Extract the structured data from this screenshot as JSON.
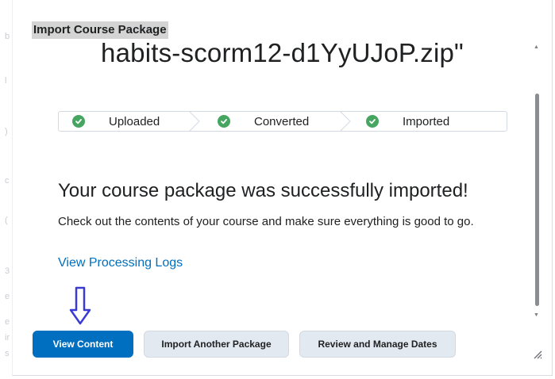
{
  "dialog": {
    "title": "Import Course Package",
    "filename": "habits-scorm12-d1YyUJoP.zip\""
  },
  "stepper": {
    "steps": [
      {
        "label": "Uploaded",
        "status": "complete"
      },
      {
        "label": "Converted",
        "status": "complete"
      },
      {
        "label": "Imported",
        "status": "complete"
      }
    ]
  },
  "message": {
    "heading": "Your course package was successfully imported!",
    "body": "Check out the contents of your course and make sure everything is good to go.",
    "link": "View Processing Logs"
  },
  "buttons": {
    "view_content": "View Content",
    "import_another": "Import Another Package",
    "review_dates": "Review and Manage Dates"
  },
  "icons": {
    "step_check": "check-circle-icon",
    "annotation_arrow": "down-arrow-icon",
    "resize": "resize-grip-icon"
  },
  "colors": {
    "primary": "#006fbf",
    "success": "#46a661",
    "secondary_button": "#e3e9f1",
    "annotation_arrow": "#3b3bd4"
  }
}
